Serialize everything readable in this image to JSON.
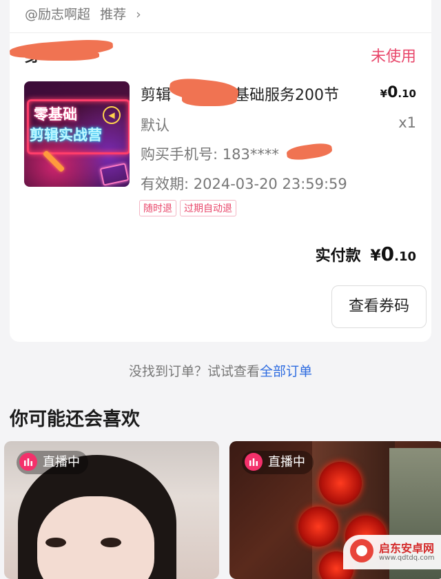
{
  "order": {
    "recommender": "@励志啊超",
    "recommend_label": "推荐",
    "shop_name": "身",
    "status": "未使用",
    "product": {
      "title_start": "剪辑",
      "title_end": "基础服务200节",
      "thumb_line1": "零基础",
      "thumb_line2": "剪辑实战营",
      "price_symbol": "¥",
      "price_int": "0",
      "price_dec": ".10",
      "variant": "默认",
      "quantity": "x1",
      "phone": "购买手机号: 183****",
      "validity": "有效期: 2024-03-20 23:59:59",
      "tags": [
        "随时退",
        "过期自动退"
      ]
    },
    "paid_label": "实付款",
    "paid_symbol": "¥",
    "paid_int": "0",
    "paid_dec": ".10",
    "view_code_button": "查看券码"
  },
  "footer_hint": {
    "text": "没找到订单？试试查看",
    "link": "全部订单"
  },
  "recommend_section": {
    "title": "你可能还会喜欢",
    "cards": [
      {
        "badge": "直播中"
      },
      {
        "badge": "直播中"
      }
    ]
  },
  "watermark": {
    "name": "启东安卓网",
    "url": "www.qdtdq.com"
  },
  "colors": {
    "accent": "#e8466a",
    "link": "#2d6be0",
    "live": "#f4316b"
  }
}
